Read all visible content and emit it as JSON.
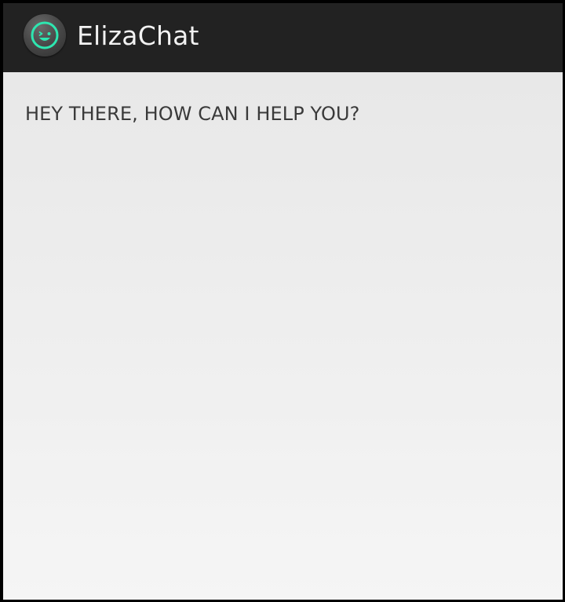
{
  "app": {
    "title": "ElizaChat",
    "icon": "smiley-wink-icon",
    "colors": {
      "action_bar": "#222222",
      "icon_accent": "#2ee6b0",
      "content_bg": "#ececec",
      "text": "#3a3a3a"
    }
  },
  "chat": {
    "greeting": "HEY THERE, HOW CAN I HELP YOU?"
  }
}
